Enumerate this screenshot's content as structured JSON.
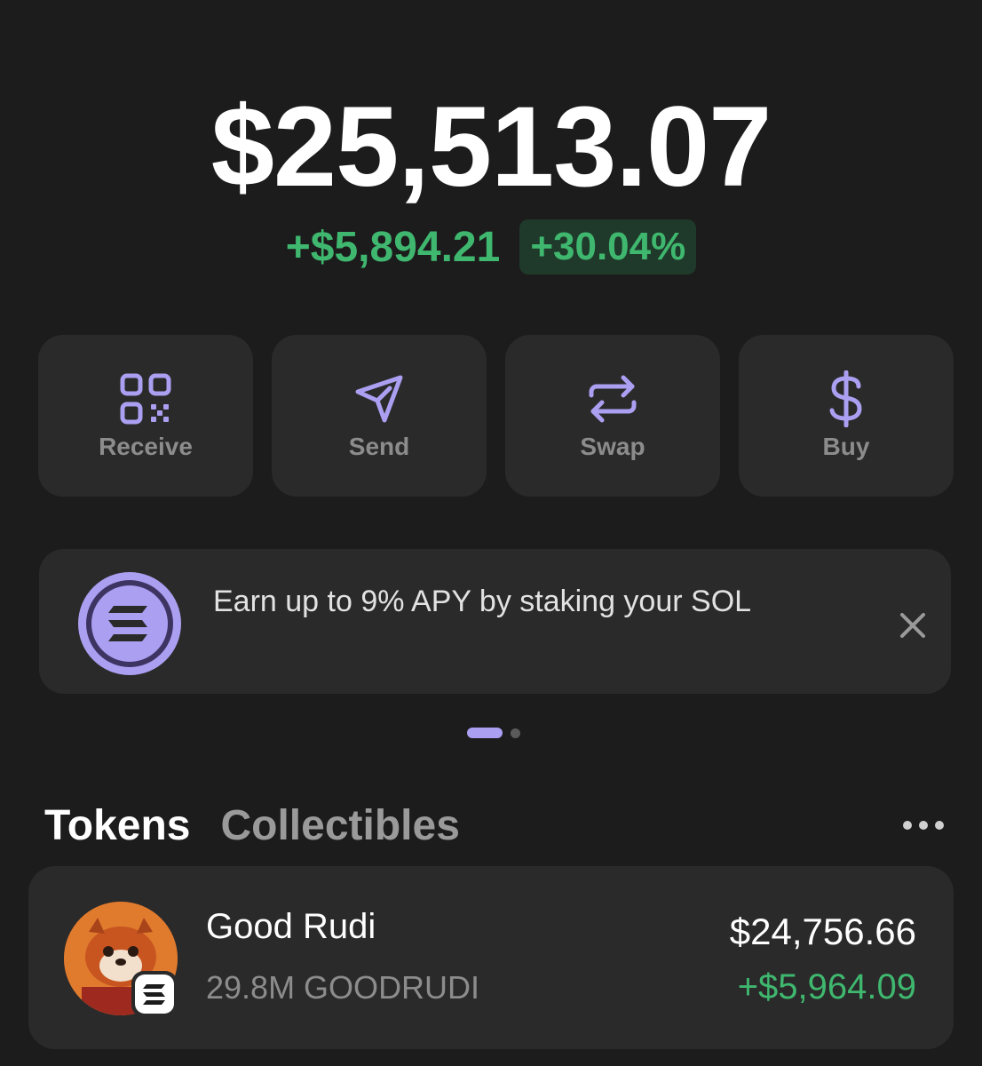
{
  "balance": "$25,513.07",
  "change": {
    "amount": "+$5,894.21",
    "percent": "+30.04%"
  },
  "actions": [
    {
      "label": "Receive",
      "icon": "qr-code-icon"
    },
    {
      "label": "Send",
      "icon": "send-icon"
    },
    {
      "label": "Swap",
      "icon": "swap-icon"
    },
    {
      "label": "Buy",
      "icon": "dollar-icon"
    }
  ],
  "banner": {
    "text": "Earn up to 9% APY by staking your SOL",
    "icon": "solana-icon"
  },
  "pager": {
    "count": 2,
    "active": 0
  },
  "tabs": {
    "tokens": "Tokens",
    "collectibles": "Collectibles"
  },
  "tokens": [
    {
      "name": "Good Rudi",
      "amount": "29.8M GOODRUDI",
      "value": "$24,756.66",
      "change": "+$5,964.09"
    }
  ],
  "colors": {
    "background": "#1c1c1c",
    "card": "#2a2a2a",
    "accent": "#ab9ff2",
    "positive": "#3fb76f"
  }
}
